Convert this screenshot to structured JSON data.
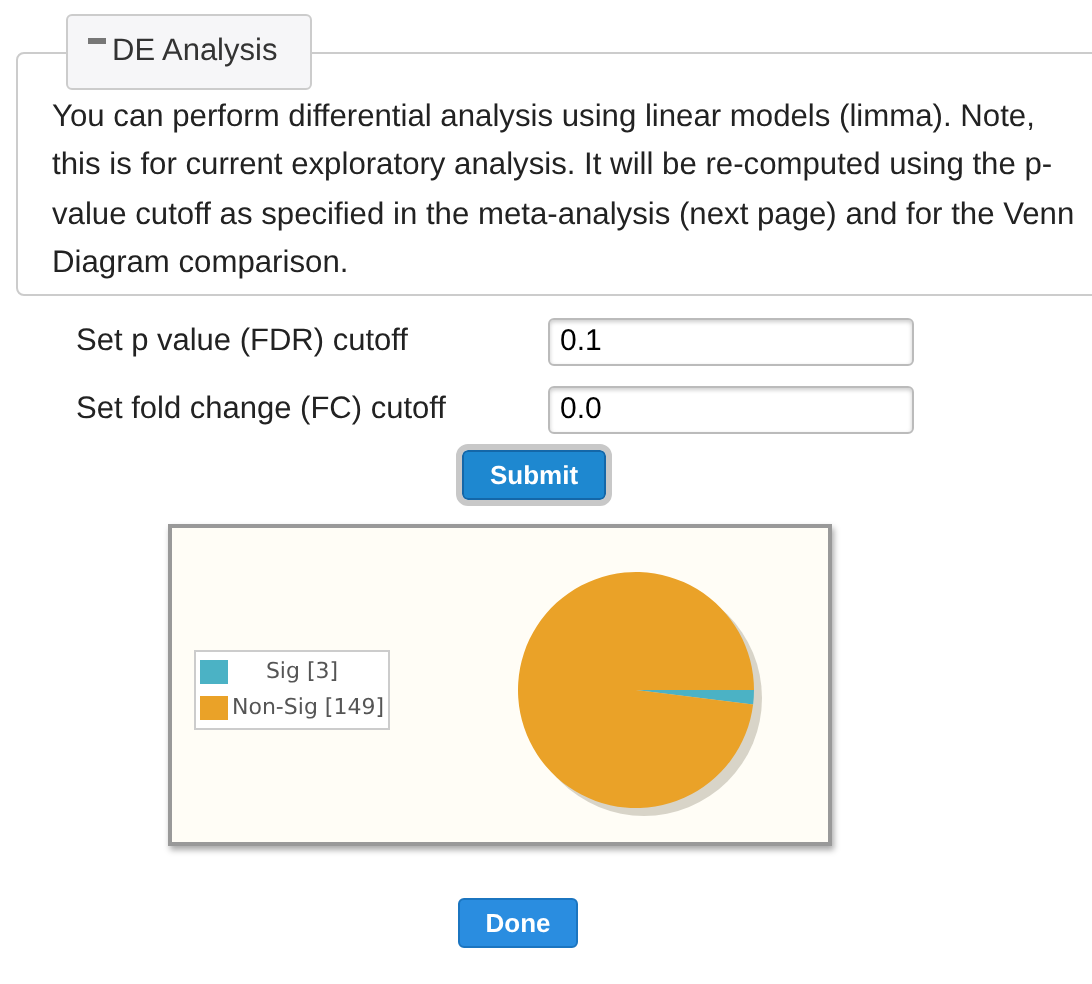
{
  "panel": {
    "title": "DE Analysis",
    "expanded": true,
    "description": "You can perform differential analysis using linear models (limma). Note, this is for current exploratory analysis. It will be re-computed using the p-value cutoff as specified in the meta-analysis (next page) and for the Venn Diagram comparison."
  },
  "fields": [
    {
      "label": "Set p value (FDR) cutoff",
      "value": "0.1"
    },
    {
      "label": "Set fold change (FC) cutoff",
      "value": "0.0"
    }
  ],
  "submit_button": "Submit",
  "chart": {
    "chart_data": {
      "type": "pie",
      "categories": [
        "Sig [3]",
        "Non-Sig [149]"
      ],
      "series": [
        {
          "values": [
            3,
            149
          ]
        }
      ],
      "legend": "left",
      "colors": [
        "#4bb2c5",
        "#eaa228"
      ]
    }
  },
  "done_button": "Done"
}
